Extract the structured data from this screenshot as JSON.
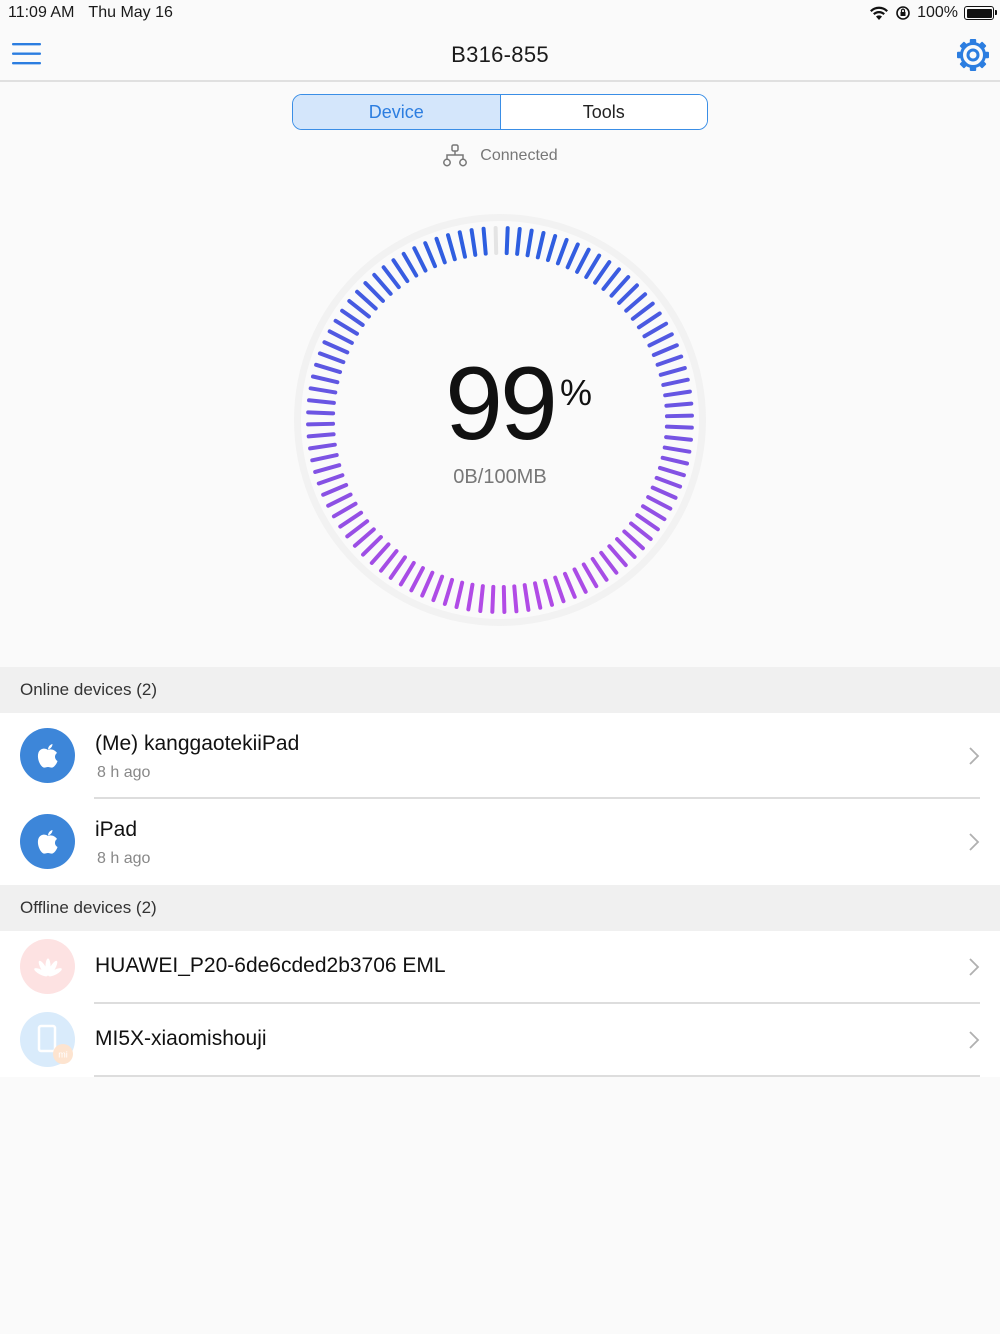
{
  "status_bar": {
    "time": "11:09 AM",
    "date": "Thu May 16",
    "battery": "100%",
    "battery_level": 1.0
  },
  "nav": {
    "title": "B316-855"
  },
  "tabs": {
    "device": "Device",
    "tools": "Tools"
  },
  "connection": {
    "status": "Connected"
  },
  "gauge": {
    "percent": "99",
    "percent_sign": "%",
    "usage": "0B/100MB",
    "percent_value": 99
  },
  "colors": {
    "accent": "#2b7de0",
    "gauge_start": "#2d5ee0",
    "gauge_end": "#b24be6",
    "apple_avatar": "#3d86d9"
  },
  "online_section": {
    "title": "Online devices (2)",
    "devices": [
      {
        "name": "(Me) kanggaotekiiPad",
        "time": "8 h ago",
        "icon": "apple-icon"
      },
      {
        "name": "iPad",
        "time": "8 h ago",
        "icon": "apple-icon"
      }
    ]
  },
  "offline_section": {
    "title": "Offline devices (2)",
    "devices": [
      {
        "name": "HUAWEI_P20-6de6cded2b3706 EML",
        "icon": "huawei-icon"
      },
      {
        "name": "MI5X-xiaomishouji",
        "icon": "xiaomi-phone-icon",
        "badge": "mi"
      }
    ]
  }
}
